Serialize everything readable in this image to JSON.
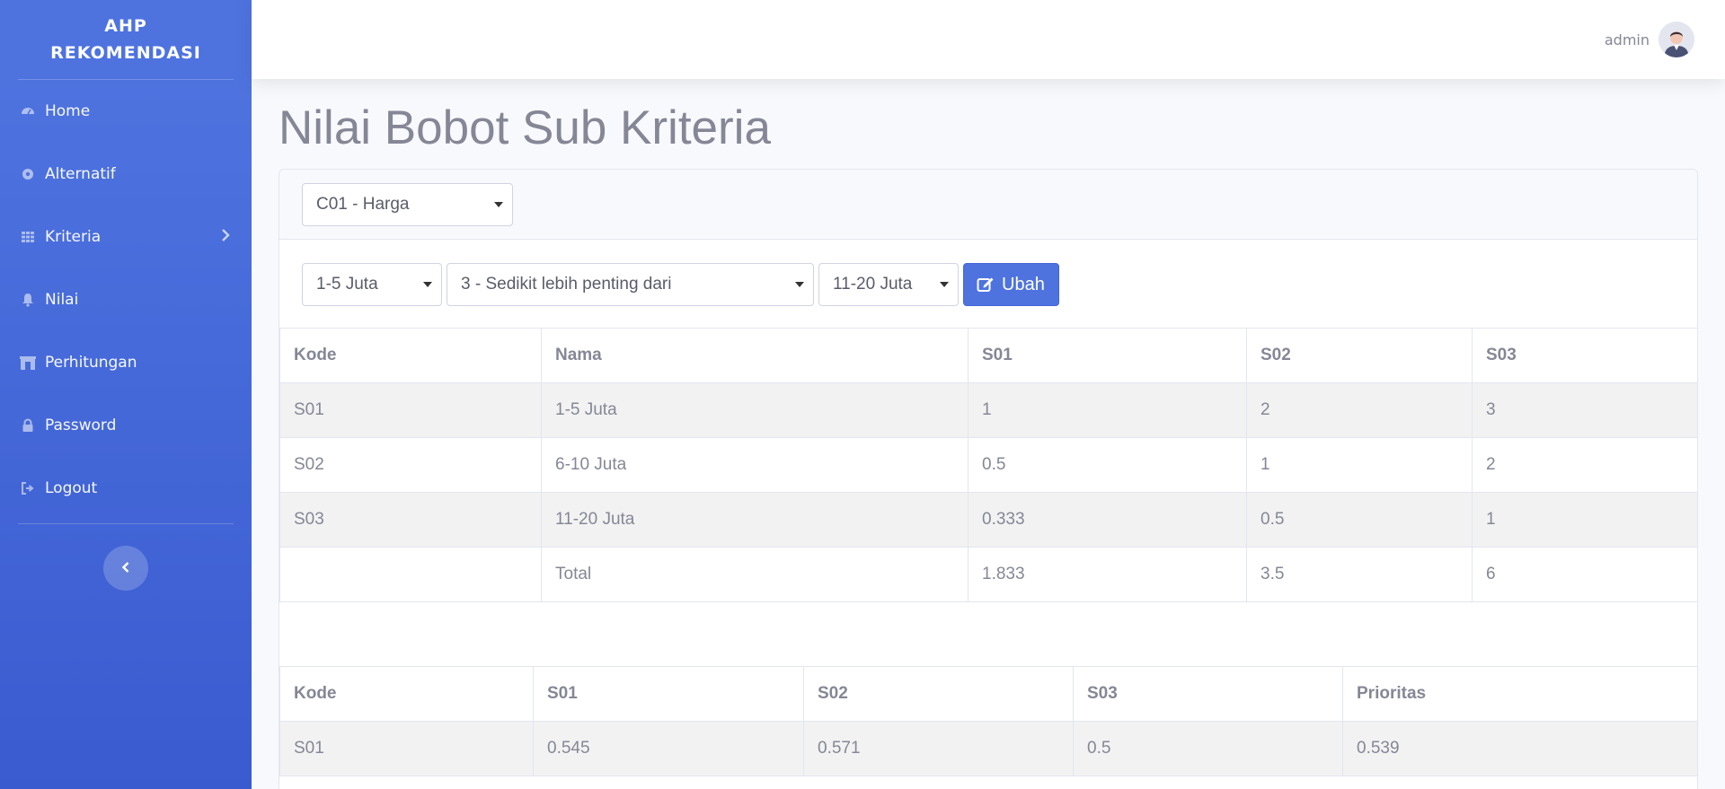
{
  "sidebar": {
    "brand_line1": "AHP",
    "brand_line2": "REKOMENDASI",
    "items": [
      {
        "label": "Home"
      },
      {
        "label": "Alternatif"
      },
      {
        "label": "Kriteria"
      },
      {
        "label": "Nilai"
      },
      {
        "label": "Perhitungan"
      },
      {
        "label": "Password"
      },
      {
        "label": "Logout"
      }
    ]
  },
  "topbar": {
    "user_name": "admin"
  },
  "page": {
    "title": "Nilai Bobot Sub Kriteria"
  },
  "filters": {
    "criteria_select": "C01 - Harga",
    "left_select": "1-5 Juta",
    "importance_select": "3 - Sedikit lebih penting dari",
    "right_select": "11-20 Juta",
    "update_button": "Ubah"
  },
  "comparison_table": {
    "headers": [
      "Kode",
      "Nama",
      "S01",
      "S02",
      "S03"
    ],
    "rows": [
      [
        "S01",
        "1-5 Juta",
        "1",
        "2",
        "3"
      ],
      [
        "S02",
        "6-10 Juta",
        "0.5",
        "1",
        "2"
      ],
      [
        "S03",
        "11-20 Juta",
        "0.333",
        "0.5",
        "1"
      ],
      [
        "",
        "Total",
        "1.833",
        "3.5",
        "6"
      ]
    ]
  },
  "priority_table": {
    "headers": [
      "Kode",
      "S01",
      "S02",
      "S03",
      "Prioritas"
    ],
    "rows": [
      [
        "S01",
        "0.545",
        "0.571",
        "0.5",
        "0.539"
      ]
    ]
  },
  "colors": {
    "primary": "#4e73df",
    "text": "#858796"
  }
}
